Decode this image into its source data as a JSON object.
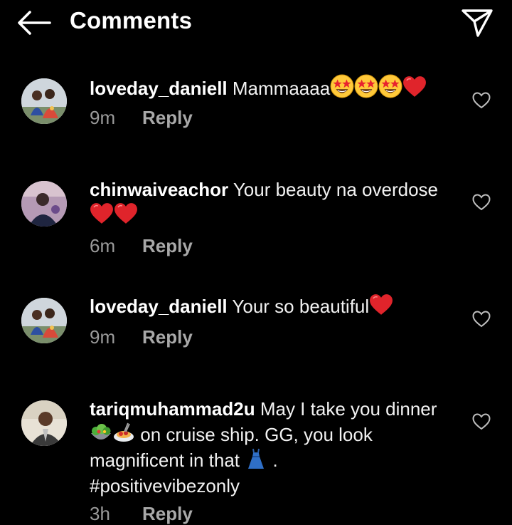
{
  "header": {
    "title": "Comments",
    "back_icon": "arrow-left-icon",
    "share_icon": "paper-plane-icon"
  },
  "comments": [
    {
      "username": "loveday_daniell",
      "text": "Mammaaaa",
      "emojis": [
        "star-struck",
        "star-struck",
        "star-struck",
        "red-heart"
      ],
      "time": "9m",
      "reply": "Reply"
    },
    {
      "username": "chinwaiveachor",
      "text": "Your beauty na overdose",
      "emojis": [
        "red-heart",
        "red-heart"
      ],
      "time": "6m",
      "reply": "Reply"
    },
    {
      "username": "loveday_daniell",
      "text": "Your so beautiful",
      "emojis": [
        "red-heart"
      ],
      "time": "9m",
      "reply": "Reply"
    },
    {
      "username": "tariqmuhammad2u",
      "text_a": "May I take you dinner",
      "text_b": "on cruise ship. GG, you look magnificent in that",
      "text_c": ".",
      "hashtag": "#positivevibezonly",
      "emojis": [
        "green-salad",
        "spaghetti",
        "dress"
      ],
      "time": "3h",
      "reply": "Reply"
    }
  ],
  "colors": {
    "background": "#000000",
    "text": "#f5f5f5",
    "meta": "#9a9a9a",
    "heart_red": "#e0242b"
  }
}
